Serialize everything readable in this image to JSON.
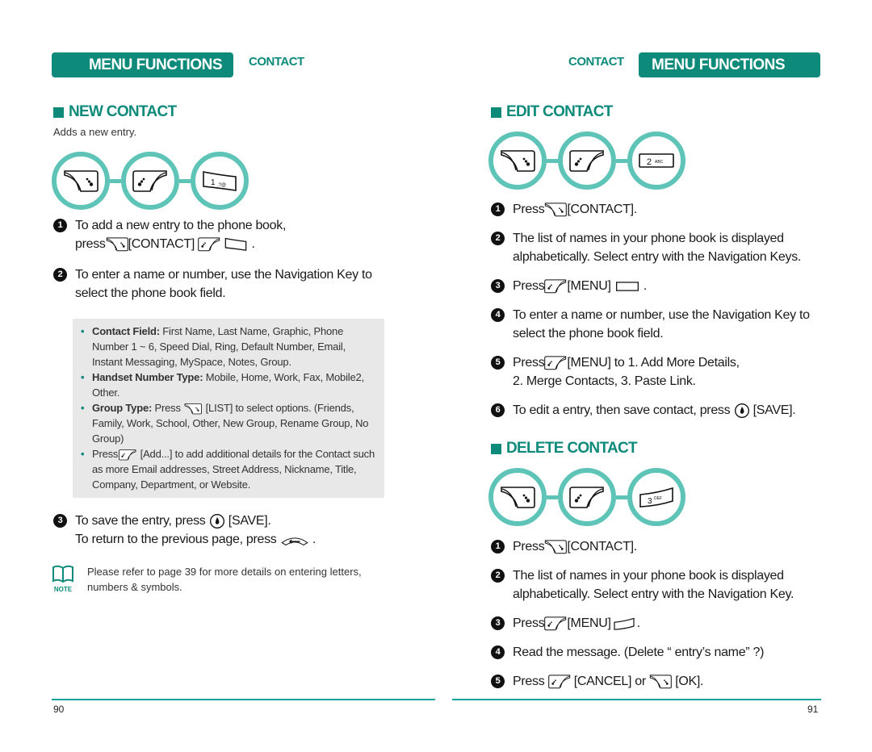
{
  "left_page": {
    "header": {
      "bar_label": "MENU FUNCTIONS",
      "tab_label": "CONTACT"
    },
    "section": {
      "title": "NEW CONTACT",
      "subtitle": "Adds a new entry.",
      "key_sequence": [
        "right-soft-key-icon",
        "left-soft-key-icon",
        "key-1-icon"
      ],
      "steps": [
        {
          "num": "1",
          "line1": "To add a new entry to the phone book,",
          "press": "press",
          "contact": "[CONTACT]",
          "end": "."
        },
        {
          "num": "2",
          "text": "To enter a name or number, use the Navigation Key to select the phone book field."
        },
        {
          "num": "3",
          "line1_a": "To save the entry, press",
          "line1_b": "[SAVE].",
          "line2_a": "To return to the previous page, press",
          "line2_b": "."
        }
      ],
      "details": [
        {
          "label": "Contact Field:",
          "text": "First Name, Last Name, Graphic, Phone Number 1 ~ 6, Speed Dial, Ring, Default Number, Email, Instant Messaging, MySpace, Notes, Group."
        },
        {
          "label": "Handset Number Type:",
          "text": "Mobile, Home, Work, Fax, Mobile2, Other."
        },
        {
          "label": "Group Type:",
          "text_a": "Press",
          "text_b": "[LIST] to select options. (Friends, Family, Work, School, Other, New Group, Rename Group, No Group)"
        },
        {
          "text_a": "Press",
          "text_b": "[Add...] to add additional details for the Contact such as more Email addresses, Street Address, Nickname, Title, Company, Department, or Website."
        }
      ],
      "note": {
        "icon_label": "NOTE",
        "text": "Please refer to page 39 for more details on entering letters, numbers & symbols."
      }
    },
    "page_number": "90"
  },
  "right_page": {
    "header": {
      "bar_label": "MENU FUNCTIONS",
      "tab_label": "CONTACT"
    },
    "edit_section": {
      "title": "EDIT CONTACT",
      "key_sequence": [
        "right-soft-key-icon",
        "left-soft-key-icon",
        "key-2-icon"
      ],
      "steps": [
        {
          "num": "1",
          "a": "Press",
          "b": "[CONTACT]."
        },
        {
          "num": "2",
          "text": "The list of names in your phone book is displayed alphabetically. Select entry with the Navigation Keys."
        },
        {
          "num": "3",
          "a": "Press",
          "b": "[MENU]",
          "c": "."
        },
        {
          "num": "4",
          "text": "To enter a name or number, use the Navigation Key to select the phone book field."
        },
        {
          "num": "5",
          "a": "Press",
          "b": "[MENU] to 1. Add More Details,",
          "c": "2. Merge Contacts, 3. Paste Link."
        },
        {
          "num": "6",
          "a": "To edit a entry, then save contact, press",
          "b": "[SAVE]."
        }
      ]
    },
    "delete_section": {
      "title": "DELETE CONTACT",
      "key_sequence": [
        "right-soft-key-icon",
        "left-soft-key-icon",
        "key-3-icon"
      ],
      "steps": [
        {
          "num": "1",
          "a": "Press",
          "b": "[CONTACT]."
        },
        {
          "num": "2",
          "text": "The list of names in your phone book is displayed alphabetically. Select entry with the Navigation Key."
        },
        {
          "num": "3",
          "a": "Press",
          "b": "[MENU]",
          "c": "."
        },
        {
          "num": "4",
          "text": "Read the message. (Delete “ entry’s name” ?)"
        },
        {
          "num": "5",
          "a": "Press",
          "b": "[CANCEL] or",
          "c": "[OK]."
        }
      ]
    },
    "page_number": "91"
  },
  "key_labels": {
    "key1": "1",
    "key1_sub": ".?@",
    "key2": "2",
    "key2_sub": "ABC",
    "key3": "3",
    "key3_sub": "DEF"
  },
  "colors": {
    "accent": "#0e8a7b",
    "ring": "#5ec4b7",
    "box": "#e8e8e8"
  }
}
